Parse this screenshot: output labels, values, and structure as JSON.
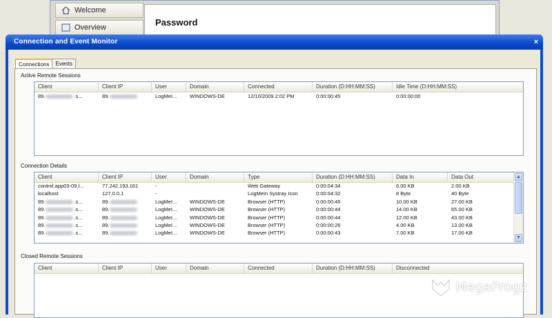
{
  "background": {
    "nav_items": [
      {
        "label": "Welcome",
        "icon": "home-icon"
      },
      {
        "label": "Overview",
        "icon": "list-icon"
      }
    ],
    "content_title": "Password"
  },
  "dialog": {
    "title": "Connection and Event Monitor",
    "close_label": "×",
    "tabs": [
      {
        "label": "Connections",
        "active": true
      },
      {
        "label": "Events",
        "active": false
      }
    ]
  },
  "active_sessions": {
    "label": "Active Remote Sessions",
    "columns": [
      "Client",
      "Client IP",
      "User",
      "Domain",
      "Connected",
      "Duration (D:HH:MM:SS)",
      "Idle Time (D:HH:MM:SS)"
    ],
    "rows": [
      [
        "89.",
        "89.",
        "LogMeI...",
        "WINDOWS-DE",
        "12/10/2009 2:02 PM",
        "0:00:00:45",
        "0:00:00:00"
      ]
    ]
  },
  "connection_details": {
    "label": "Connection Details",
    "columns": [
      "Client",
      "Client IP",
      "User",
      "Domain",
      "Type",
      "Duration (D:HH:MM:SS)",
      "Data In",
      "Data Out"
    ],
    "rows": [
      [
        "control.app03-09.l...",
        "77.242.193.161",
        "-",
        "",
        "Web Gateway",
        "0:00:04:34",
        "6.00 KB",
        "2.00 KB"
      ],
      [
        "localhost",
        "127.0.0.1",
        "-",
        "",
        "LogMeIn Systray Icon",
        "0:00:04:32",
        "8 Byte",
        "40 Byte"
      ],
      [
        "89.",
        "89.",
        "LogMeI...",
        "WINDOWS-DE",
        "Browser (HTTP)",
        "0:00:00:45",
        "10.00 KB",
        "27.00 KB"
      ],
      [
        "89.",
        "89.",
        "LogMeI...",
        "WINDOWS-DE",
        "Browser (HTTP)",
        "0:00:00:44",
        "14.00 KB",
        "65.00 KB"
      ],
      [
        "89.",
        "89.",
        "LogMeI...",
        "WINDOWS-DE",
        "Browser (HTTP)",
        "0:00:00:44",
        "12.00 KB",
        "43.00 KB"
      ],
      [
        "89.",
        "89.",
        "LogMeI...",
        "WINDOWS-DE",
        "Browser (HTTP)",
        "0:00:00:26",
        "4.00 KB",
        "13.00 KB"
      ],
      [
        "89.",
        "89.",
        "LogMeI...",
        "WINDOWS-DE",
        "Browser (HTTP)",
        "0:00:00:43",
        "7.00 KB",
        "17.00 KB"
      ]
    ]
  },
  "closed_sessions": {
    "label": "Closed Remote Sessions",
    "columns": [
      "Client",
      "Client IP",
      "User",
      "Domain",
      "Connected",
      "Duration (D:HH:MM:SS)",
      "Disconnected"
    ]
  },
  "watermark": {
    "text": "MegaProgz"
  },
  "colors": {
    "titlebar": "#0a49c8",
    "tab_accent": "#f3b13c",
    "grid_border": "#7f9db9"
  }
}
